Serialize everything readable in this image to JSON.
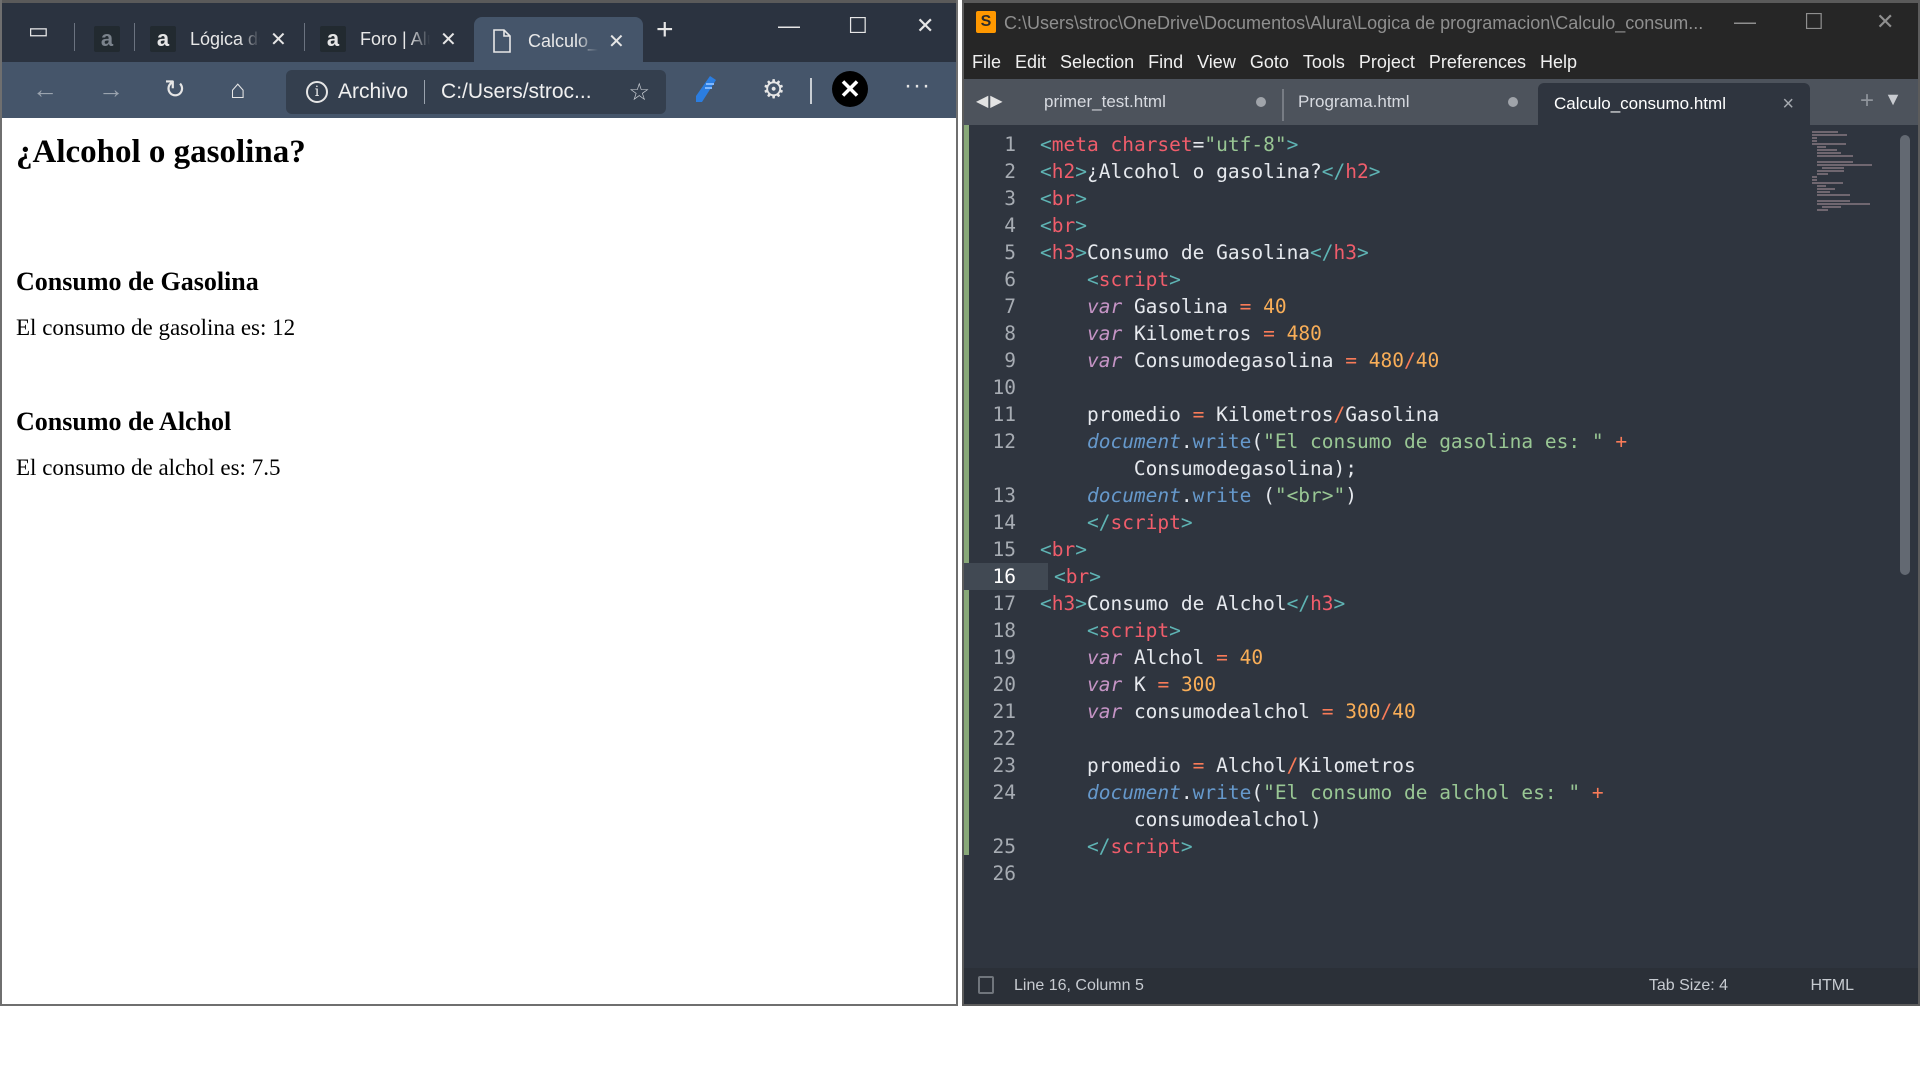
{
  "browser": {
    "tabs": [
      {
        "label": "",
        "favicon": "a",
        "dim": true
      },
      {
        "label": "Lógica de programación",
        "favicon": "a"
      },
      {
        "label": "Foro | Alura",
        "favicon": "a"
      },
      {
        "label": "Calculo_consumo.html",
        "favicon": "file-icon",
        "active": true
      }
    ],
    "new_tab": "+",
    "window_controls": {
      "minimize": "—",
      "maximize": "☐",
      "close": "✕"
    },
    "toolbar": {
      "back": "←",
      "forward": "→",
      "reload": "↻",
      "home": "⌂",
      "info_label": "i",
      "scheme_label": "Archivo",
      "address": "C:/Users/stroc...",
      "more": "···"
    },
    "page": {
      "title": "¿Alcohol o gasolina?",
      "section1_heading": "Consumo de Gasolina",
      "section1_text": "El consumo de gasolina es: 12",
      "section2_heading": "Consumo de Alchol",
      "section2_text": "El consumo de alchol es: 7.5"
    }
  },
  "editor": {
    "title": "C:\\Users\\stroc\\OneDrive\\Documentos\\Alura\\Logica de programacion\\Calculo_consum...",
    "menu": [
      "File",
      "Edit",
      "Selection",
      "Find",
      "View",
      "Goto",
      "Tools",
      "Project",
      "Preferences",
      "Help"
    ],
    "tabs": [
      {
        "label": "primer_test.html",
        "modified": true
      },
      {
        "label": "Programa.html",
        "modified": true
      },
      {
        "label": "Calculo_consumo.html",
        "active": true,
        "close": "×"
      }
    ],
    "current_line": 16,
    "code": [
      {
        "n": "1",
        "tokens": [
          [
            "t-br",
            "<"
          ],
          [
            "t-tag",
            "meta"
          ],
          [
            "t-pl",
            " "
          ],
          [
            "t-attr",
            "charset"
          ],
          [
            "t-pl",
            "="
          ],
          [
            "t-str",
            "\"utf-8\""
          ],
          [
            "t-br",
            ">"
          ]
        ]
      },
      {
        "n": "2",
        "tokens": [
          [
            "t-br",
            "<"
          ],
          [
            "t-tag",
            "h2"
          ],
          [
            "t-br",
            ">"
          ],
          [
            "t-pl",
            "¿Alcohol o gasolina?"
          ],
          [
            "t-br",
            "</"
          ],
          [
            "t-tag",
            "h2"
          ],
          [
            "t-br",
            ">"
          ]
        ]
      },
      {
        "n": "3",
        "tokens": [
          [
            "t-br",
            "<"
          ],
          [
            "t-tag",
            "br"
          ],
          [
            "t-br",
            ">"
          ]
        ]
      },
      {
        "n": "4",
        "tokens": [
          [
            "t-br",
            "<"
          ],
          [
            "t-tag",
            "br"
          ],
          [
            "t-br",
            ">"
          ]
        ]
      },
      {
        "n": "5",
        "tokens": [
          [
            "t-br",
            "<"
          ],
          [
            "t-tag",
            "h3"
          ],
          [
            "t-br",
            ">"
          ],
          [
            "t-pl",
            "Consumo de Gasolina"
          ],
          [
            "t-br",
            "</"
          ],
          [
            "t-tag",
            "h3"
          ],
          [
            "t-br",
            ">"
          ]
        ]
      },
      {
        "n": "6",
        "indent": 1,
        "tokens": [
          [
            "t-br",
            "<"
          ],
          [
            "t-tag",
            "script"
          ],
          [
            "t-br",
            ">"
          ]
        ]
      },
      {
        "n": "7",
        "indent": 1,
        "tokens": [
          [
            "t-kw",
            "var"
          ],
          [
            "t-pl",
            " Gasolina "
          ],
          [
            "t-op",
            "="
          ],
          [
            "t-pl",
            " "
          ],
          [
            "t-num",
            "40"
          ]
        ]
      },
      {
        "n": "8",
        "indent": 1,
        "tokens": [
          [
            "t-kw",
            "var"
          ],
          [
            "t-pl",
            " Kilometros "
          ],
          [
            "t-op",
            "="
          ],
          [
            "t-pl",
            " "
          ],
          [
            "t-num",
            "480"
          ]
        ]
      },
      {
        "n": "9",
        "indent": 1,
        "tokens": [
          [
            "t-kw",
            "var"
          ],
          [
            "t-pl",
            " Consumodegasolina "
          ],
          [
            "t-op",
            "="
          ],
          [
            "t-pl",
            " "
          ],
          [
            "t-num",
            "480"
          ],
          [
            "t-op",
            "/"
          ],
          [
            "t-num",
            "40"
          ]
        ]
      },
      {
        "n": "10",
        "indent": 1,
        "tokens": []
      },
      {
        "n": "11",
        "indent": 1,
        "tokens": [
          [
            "t-pl",
            "promedio "
          ],
          [
            "t-op",
            "="
          ],
          [
            "t-pl",
            " Kilometros"
          ],
          [
            "t-op",
            "/"
          ],
          [
            "t-pl",
            "Gasolina"
          ]
        ]
      },
      {
        "n": "12",
        "indent": 1,
        "tokens": [
          [
            "t-obj",
            "document"
          ],
          [
            "t-pl",
            "."
          ],
          [
            "t-fn",
            "write"
          ],
          [
            "t-pl",
            "("
          ],
          [
            "t-str",
            "\"El consumo de gasolina es: \""
          ],
          [
            "t-pl",
            " "
          ],
          [
            "t-op",
            "+"
          ]
        ]
      },
      {
        "n": "",
        "indent": 2,
        "tokens": [
          [
            "t-pl",
            "Consumodegasolina);"
          ]
        ]
      },
      {
        "n": "13",
        "indent": 1,
        "tokens": [
          [
            "t-obj",
            "document"
          ],
          [
            "t-pl",
            "."
          ],
          [
            "t-fn",
            "write"
          ],
          [
            "t-pl",
            " ("
          ],
          [
            "t-str",
            "\"<br>\""
          ],
          [
            "t-pl",
            ")"
          ]
        ]
      },
      {
        "n": "14",
        "indent": 1,
        "tokens": [
          [
            "t-br",
            "</"
          ],
          [
            "t-tag",
            "script"
          ],
          [
            "t-br",
            ">"
          ]
        ]
      },
      {
        "n": "15",
        "tokens": [
          [
            "t-br",
            "<"
          ],
          [
            "t-tag",
            "br"
          ],
          [
            "t-br",
            ">"
          ]
        ]
      },
      {
        "n": "16",
        "tokens": [
          [
            "t-br",
            "<"
          ],
          [
            "t-tag",
            "br"
          ],
          [
            "t-br",
            ">"
          ]
        ]
      },
      {
        "n": "17",
        "tokens": [
          [
            "t-br",
            "<"
          ],
          [
            "t-tag",
            "h3"
          ],
          [
            "t-br",
            ">"
          ],
          [
            "t-pl",
            "Consumo de Alchol"
          ],
          [
            "t-br",
            "</"
          ],
          [
            "t-tag",
            "h3"
          ],
          [
            "t-br",
            ">"
          ]
        ]
      },
      {
        "n": "18",
        "indent": 1,
        "tokens": [
          [
            "t-br",
            "<"
          ],
          [
            "t-tag",
            "script"
          ],
          [
            "t-br",
            ">"
          ]
        ]
      },
      {
        "n": "19",
        "indent": 1,
        "tokens": [
          [
            "t-kw",
            "var"
          ],
          [
            "t-pl",
            " Alchol "
          ],
          [
            "t-op",
            "="
          ],
          [
            "t-pl",
            " "
          ],
          [
            "t-num",
            "40"
          ]
        ]
      },
      {
        "n": "20",
        "indent": 1,
        "tokens": [
          [
            "t-kw",
            "var"
          ],
          [
            "t-pl",
            " K "
          ],
          [
            "t-op",
            "="
          ],
          [
            "t-pl",
            " "
          ],
          [
            "t-num",
            "300"
          ]
        ]
      },
      {
        "n": "21",
        "indent": 1,
        "tokens": [
          [
            "t-kw",
            "var"
          ],
          [
            "t-pl",
            " consumodealchol "
          ],
          [
            "t-op",
            "="
          ],
          [
            "t-pl",
            " "
          ],
          [
            "t-num",
            "300"
          ],
          [
            "t-op",
            "/"
          ],
          [
            "t-num",
            "40"
          ]
        ]
      },
      {
        "n": "22",
        "indent": 1,
        "tokens": []
      },
      {
        "n": "23",
        "indent": 1,
        "tokens": [
          [
            "t-pl",
            "promedio "
          ],
          [
            "t-op",
            "="
          ],
          [
            "t-pl",
            " Alchol"
          ],
          [
            "t-op",
            "/"
          ],
          [
            "t-pl",
            "Kilometros"
          ]
        ]
      },
      {
        "n": "24",
        "indent": 1,
        "tokens": [
          [
            "t-obj",
            "document"
          ],
          [
            "t-pl",
            "."
          ],
          [
            "t-fn",
            "write"
          ],
          [
            "t-pl",
            "("
          ],
          [
            "t-str",
            "\"El consumo de alchol es: \""
          ],
          [
            "t-pl",
            " "
          ],
          [
            "t-op",
            "+"
          ]
        ]
      },
      {
        "n": "",
        "indent": 2,
        "tokens": [
          [
            "t-pl",
            "consumodealchol)"
          ]
        ]
      },
      {
        "n": "25",
        "indent": 1,
        "tokens": [
          [
            "t-br",
            "</"
          ],
          [
            "t-tag",
            "script"
          ],
          [
            "t-br",
            ">"
          ]
        ]
      },
      {
        "n": "26",
        "tokens": []
      }
    ],
    "status": {
      "position": "Line 16, Column 5",
      "tab_size": "Tab Size: 4",
      "syntax": "HTML"
    }
  }
}
